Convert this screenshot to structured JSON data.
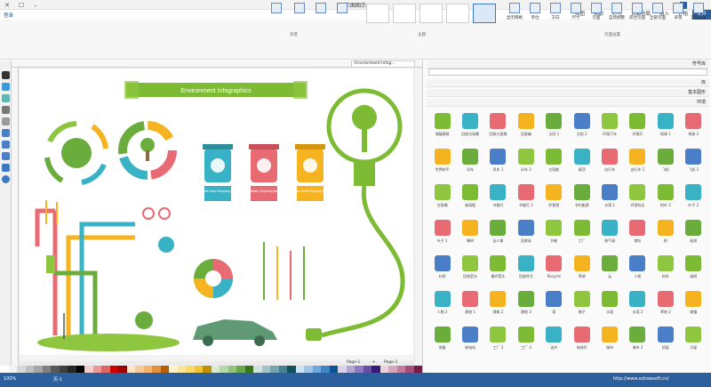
{
  "titlebar": {
    "title": "亿图图示"
  },
  "menubar": {
    "items": [
      "文件",
      "开始",
      "插入",
      "页面布局",
      "符号",
      "帮助",
      "视图"
    ],
    "file": "文件",
    "login": "登录"
  },
  "ribbon": {
    "buttons": [
      "页面设置",
      "背景",
      "全部页面",
      "适合页面",
      "自动调整",
      "页面",
      "尺寸",
      "方向",
      "单位",
      "显示网格"
    ],
    "groups": [
      "页面设置",
      "主题",
      "背景"
    ],
    "theme_label": "主题",
    "bg_label": "背景"
  },
  "doc": {
    "tab": "Environment Infog...",
    "page_tab": "Page-1",
    "page_tab2": "Page-1"
  },
  "infographic": {
    "banner": "Environment Infographics",
    "bins": [
      {
        "label": "Waste Paper Recycling Bin",
        "color": "#38b2c4"
      },
      {
        "label": "Battery Recycling Bin",
        "color": "#e86a73"
      },
      {
        "label": "Glass Bottle Recycling Bin",
        "color": "#f5b31f"
      }
    ]
  },
  "library": {
    "headers": [
      "符号库",
      "库",
      "基本图形",
      "环境"
    ],
    "search_placeholder": "",
    "cells": [
      "城镇建筑",
      "回收垃圾桶",
      "回收分类桶",
      "回收箱",
      "太阳 1",
      "太阳 2",
      "环保汽车",
      "环保灯",
      "地球 1",
      "地球 2",
      "世界和平",
      "风车",
      "风车 1",
      "风车 2",
      "太阳能",
      "屋顶",
      "自行车",
      "自行车 2",
      "飞机",
      "飞机 2",
      "垃圾桶",
      "玻璃瓶",
      "节能灯",
      "节能灯 2",
      "环保袋",
      "节约能源",
      "水滴 1",
      "环保标志",
      "树叶 2",
      "叶子 2",
      "叶子 1",
      "橡树",
      "仙人掌",
      "回收站",
      "节能",
      "工厂",
      "热气球",
      "储存",
      "树",
      "松树",
      "杉树",
      "回收箭头",
      "循环箭头",
      "回收符号",
      "Recycle",
      "草地",
      "云",
      "人物",
      "树木",
      "绿树",
      "人物 2",
      "建筑 1",
      "建筑 2",
      "建筑 3",
      "塔",
      "梯子",
      "水塔",
      "水塔 2",
      "草地 2",
      "城镇",
      "房屋",
      "核电站",
      "工厂 2",
      "工厂 3",
      "油井",
      "电线杆",
      "城市",
      "城市 2",
      "桥梁",
      "大厦",
      "大楼",
      "汽车",
      "汽车 2",
      "塔吊",
      "吊车",
      "起重机",
      "起重机 2",
      "吊塔",
      "电塔",
      "电塔 2",
      "铁塔"
    ]
  },
  "status": {
    "url": "http://www.edrawsoft.cn/",
    "page": "页-1",
    "zoom": "100%"
  },
  "palette_colors": [
    "#ffffff",
    "#f2f2f2",
    "#d8d8d8",
    "#bfbfbf",
    "#a5a5a5",
    "#7f7f7f",
    "#595959",
    "#3f3f3f",
    "#262626",
    "#000000",
    "#f4cccc",
    "#ea9999",
    "#e06666",
    "#cc0000",
    "#990000",
    "#fce5cd",
    "#f9cb9c",
    "#f6b26b",
    "#e69138",
    "#b45f06",
    "#fff2cc",
    "#ffe599",
    "#ffd966",
    "#f1c232",
    "#bf9000",
    "#d9ead3",
    "#b6d7a8",
    "#93c47d",
    "#6aa84f",
    "#38761d",
    "#d0e0e3",
    "#a2c4c9",
    "#76a5af",
    "#45818e",
    "#134f5c",
    "#cfe2f3",
    "#9fc5e8",
    "#6fa8dc",
    "#3d85c6",
    "#0b5394",
    "#d9d2e9",
    "#b4a7d6",
    "#8e7cc3",
    "#674ea7",
    "#351c75",
    "#ead1dc",
    "#d5a6bd",
    "#c27ba0",
    "#a64d79",
    "#741b47"
  ]
}
